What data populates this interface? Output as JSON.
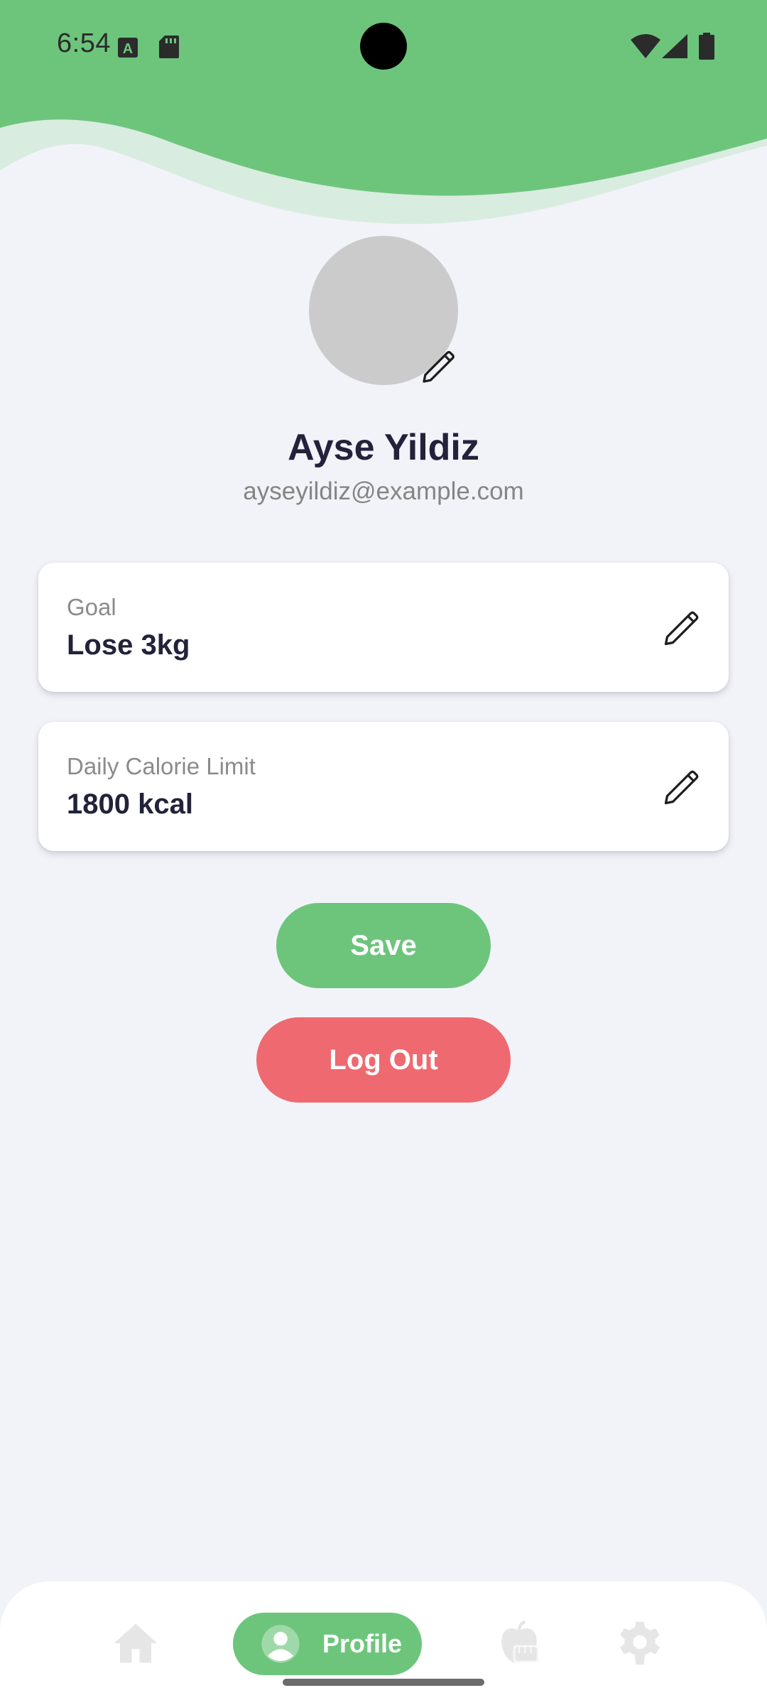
{
  "status_bar": {
    "time": "6:54",
    "left_icons": [
      "a-notification-icon",
      "sd-card-icon"
    ],
    "right_icons": [
      "wifi-icon",
      "signal-icon",
      "battery-icon"
    ]
  },
  "colors": {
    "primary_green": "#6dc57c",
    "light_green": "#d9ece0",
    "logout_red": "#ee6a70",
    "background": "#f2f3f9",
    "text_dark": "#22223b"
  },
  "profile": {
    "name": "Ayse Yildiz",
    "email": "ayseyildiz@example.com",
    "avatar_edit_icon": "pencil-icon"
  },
  "cards": [
    {
      "label": "Goal",
      "value": "Lose 3kg",
      "edit_icon": "pencil-icon"
    },
    {
      "label": "Daily Calorie Limit",
      "value": "1800 kcal",
      "edit_icon": "pencil-icon"
    }
  ],
  "buttons": {
    "save": "Save",
    "logout": "Log Out"
  },
  "bottom_nav": {
    "items": [
      {
        "icon": "home-icon",
        "label": "",
        "active": false
      },
      {
        "icon": "profile-icon",
        "label": "Profile",
        "active": true
      },
      {
        "icon": "apple-scale-icon",
        "label": "",
        "active": false
      },
      {
        "icon": "gear-icon",
        "label": "",
        "active": false
      }
    ]
  }
}
